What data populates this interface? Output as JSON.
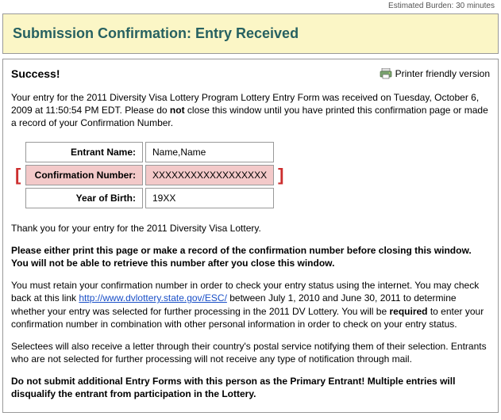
{
  "burden_text": "Estimated Burden: 30 minutes",
  "title": "Submission Confirmation: Entry Received",
  "success_heading": "Success!",
  "printer_link": "Printer friendly version",
  "intro": {
    "pre": "Your entry for the 2011 Diversity Visa Lottery Program Lottery Entry Form was received on Tuesday, October 6, 2009 at 11:50:54 PM EDT. Please do ",
    "bold1": "not",
    "post": " close this window until you have printed this confirmation page or made a record of your Confirmation Number."
  },
  "table": {
    "rows": [
      {
        "label": "Entrant Name:",
        "value": "Name,Name"
      },
      {
        "label": "Confirmation Number:",
        "value": "XXXXXXXXXXXXXXXXXX"
      },
      {
        "label": "Year of Birth:",
        "value": "19XX"
      }
    ]
  },
  "thanks": "Thank you for your entry for the 2011 Diversity Visa Lottery.",
  "warn": "Please either print this page or make a record of the confirmation number before closing this window. You will not be able to retrieve this number after you close this window.",
  "retain": {
    "p1a": "You must retain your confirmation number in order to check your entry status using the internet. You may check back at this link ",
    "link_text": "http://www.dvlottery.state.gov/ESC/",
    "p1b": " between July 1, 2010 and June 30, 2011 to determine whether your entry was selected for further processing in the 2011 DV Lottery. You will be ",
    "bold": "required",
    "p1c": " to enter your confirmation number in combination with other personal information in order to check on your entry status."
  },
  "selectees": "Selectees will also receive a letter through their country's postal service notifying them of their selection. Entrants who are not selected for further processing will not receive any type of notification through mail.",
  "nosubmit": "Do not submit additional Entry Forms with this person as the Primary Entrant! Multiple entries will disqualify the entrant from participation in the Lottery."
}
